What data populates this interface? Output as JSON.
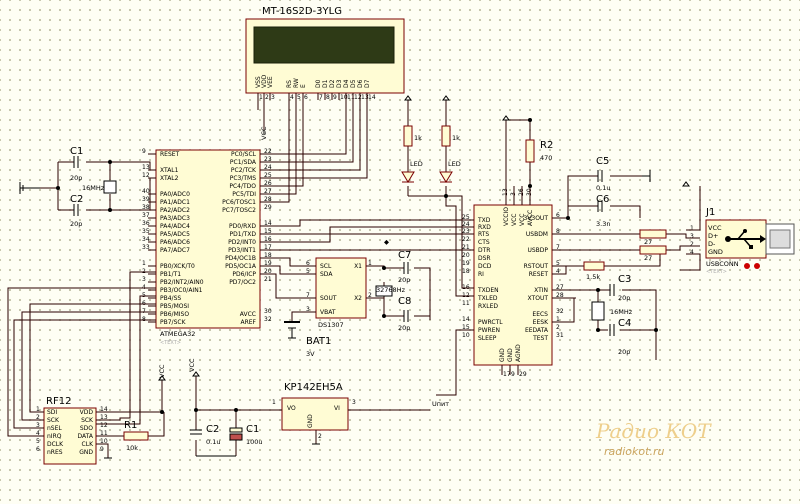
{
  "lcd": {
    "name": "MT-16S2D-3YLG",
    "pins": [
      "VSS",
      "VDD",
      "VEE",
      "RS",
      "RW",
      "E",
      "D0",
      "D1",
      "D2",
      "D3",
      "D4",
      "D5",
      "D6",
      "D7"
    ],
    "nums": [
      "1",
      "2",
      "3",
      "4",
      "5",
      "6",
      "7",
      "8",
      "9",
      "10",
      "11",
      "12",
      "13",
      "14"
    ]
  },
  "mcu": {
    "name": "ATMEGA32",
    "text": "<TEXT>",
    "left_pins": [
      "RESET",
      "XTAL1",
      "XTAL2",
      "PA0/ADC0",
      "PA1/ADC1",
      "PA2/ADC2",
      "PA3/ADC3",
      "PA4/ADC4",
      "PA5/ADC5",
      "PA6/ADC6",
      "PA7/ADC7",
      "PB0/XCK/T0",
      "PB1/T1",
      "PB2/INT2/AIN0",
      "PB3/OC0/AIN1",
      "PB4/SS",
      "PB5/MOSI",
      "PB6/MISO",
      "PB7/SCK"
    ],
    "left_nums": [
      "9",
      "13",
      "12",
      "40",
      "39",
      "38",
      "37",
      "36",
      "35",
      "34",
      "33",
      "1",
      "2",
      "3",
      "4",
      "5",
      "6",
      "7",
      "8"
    ],
    "right_pins": [
      "PC0/SCL",
      "PC1/SDA",
      "PC2/TCK",
      "PC3/TMS",
      "PC4/TDO",
      "PC5/TDI",
      "PC6/TOSC1",
      "PC7/TOSC2",
      "PD0/RXD",
      "PD1/TXD",
      "PD2/INT0",
      "PD3/INT1",
      "PD4/OC1B",
      "PD5/OC1A",
      "PD6/ICP",
      "PD7/OC2",
      "AVCC",
      "AREF"
    ],
    "right_nums": [
      "22",
      "23",
      "24",
      "25",
      "26",
      "27",
      "28",
      "29",
      "14",
      "15",
      "16",
      "17",
      "18",
      "19",
      "20",
      "21",
      "30",
      "32"
    ]
  },
  "rtc": {
    "name": "DS1307",
    "left_pins": [
      "SCL",
      "SDA",
      "SOUT",
      "VBAT"
    ],
    "left_nums": [
      "6",
      "5",
      "7",
      "3"
    ],
    "right_pins": [
      "X1",
      "X2"
    ],
    "right_nums": [
      "1",
      "2"
    ]
  },
  "ftdi": {
    "name": "FT232BM",
    "left_pins": [
      "TXD",
      "RXD",
      "RTS",
      "CTS",
      "DTR",
      "DSR",
      "DCD",
      "RI",
      "TXDEN",
      "TXLED",
      "RXLED",
      "PWRCTL",
      "PWREN",
      "SLEEP"
    ],
    "left_nums": [
      "25",
      "24",
      "23",
      "22",
      "21",
      "20",
      "19",
      "18",
      "16",
      "12",
      "11",
      "14",
      "15",
      "10"
    ],
    "right_pins": [
      "3V3OUT",
      "USBDM",
      "USBDP",
      "RSTOUT",
      "RESET",
      "XTIN",
      "XTOUT",
      "EECS",
      "EESK",
      "EEDATA",
      "TEST"
    ],
    "right_nums": [
      "6",
      "8",
      "7",
      "5",
      "4",
      "27",
      "28",
      "32",
      "1",
      "2",
      "31"
    ],
    "top_pins": [
      "VCCIO",
      "VCC",
      "VCC",
      "AVCC"
    ],
    "top_nums": [
      "13",
      "3",
      "26",
      "30"
    ],
    "bottom_pins": [
      "GND",
      "GND",
      "AGND"
    ],
    "bottom_nums": [
      "17",
      "9",
      "29"
    ]
  },
  "rf": {
    "name": "RF12",
    "left_pins": [
      "SDI",
      "SCK",
      "nSEL",
      "nIRQ",
      "DCLK",
      "nRES"
    ],
    "right_pins": [
      "VDD",
      "SCK",
      "SDO",
      "DATA",
      "CLK",
      "GND"
    ],
    "left_nums": [
      "1",
      "2",
      "3",
      "4",
      "5",
      "6"
    ],
    "right_nums": [
      "14",
      "13",
      "12",
      "11",
      "10",
      "9"
    ]
  },
  "reg": {
    "name": "KP142EH5A",
    "in": "VI",
    "out": "VO",
    "gnd": "GND",
    "nums": [
      "1",
      "2",
      "3"
    ]
  },
  "usb": {
    "name": "J1",
    "conn": "USBCONN",
    "text": "<TEXT>",
    "pins": [
      "VCC",
      "D+",
      "D-",
      "GND"
    ],
    "nums": [
      "1",
      "3",
      "2",
      "4"
    ]
  },
  "parts": {
    "c1": {
      "ref": "C1",
      "val": "20p"
    },
    "c2": {
      "ref": "C2",
      "val": "20p"
    },
    "xtal1": {
      "ref": "16MHz"
    },
    "r2": {
      "ref": "R2",
      "val": "470"
    },
    "c5": {
      "ref": "C5",
      "val": "0.1u"
    },
    "c6": {
      "ref": "C6",
      "val": "3.3n"
    },
    "r27a": {
      "val": "27"
    },
    "r27b": {
      "val": "27"
    },
    "r15": {
      "val": "1.5k"
    },
    "c3": {
      "ref": "C3",
      "val": "20p"
    },
    "c4": {
      "ref": "C4",
      "val": "20p"
    },
    "xtal2": {
      "ref": "16MHz"
    },
    "c7": {
      "ref": "C7",
      "val": "20p"
    },
    "c8": {
      "ref": "C8",
      "val": "20p"
    },
    "xtal3": {
      "ref": "32768Hz"
    },
    "bat": {
      "ref": "BAT1",
      "val": "3V"
    },
    "r1": {
      "ref": "R1",
      "val": "10k"
    },
    "c2b": {
      "ref": "C2",
      "val": "0.1u"
    },
    "c1b": {
      "ref": "C1",
      "val": "100u"
    },
    "led1": {
      "ref": "LED"
    },
    "led2": {
      "ref": "LED"
    },
    "rled1": {
      "val": "1k"
    },
    "rled2": {
      "val": "1k"
    }
  },
  "nets": {
    "vcc": "VCC",
    "upit": "Uпит"
  },
  "watermark": {
    "line1": "Радио КОТ",
    "line2": "radiokot.ru"
  }
}
